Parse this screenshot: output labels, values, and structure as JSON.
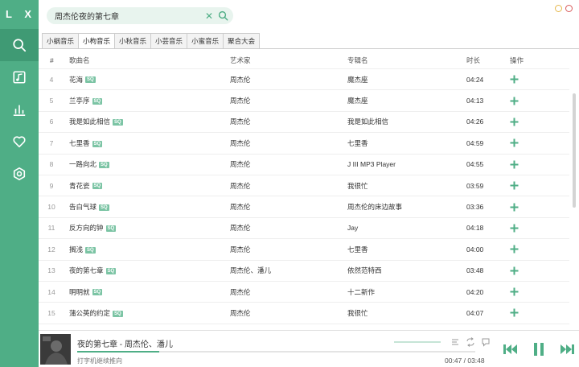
{
  "app": {
    "logo": "L X"
  },
  "sidebar": {
    "items": [
      {
        "icon": "search-icon",
        "active": true
      },
      {
        "icon": "music-file-icon",
        "active": false
      },
      {
        "icon": "chart-icon",
        "active": false
      },
      {
        "icon": "heart-icon",
        "active": false
      },
      {
        "icon": "settings-icon",
        "active": false
      }
    ]
  },
  "search": {
    "value": "周杰伦夜的第七章"
  },
  "tabs": [
    {
      "label": "小蜗音乐",
      "active": false
    },
    {
      "label": "小枸音乐",
      "active": true
    },
    {
      "label": "小秋音乐",
      "active": false
    },
    {
      "label": "小芸音乐",
      "active": false
    },
    {
      "label": "小蜜音乐",
      "active": false
    },
    {
      "label": "聚合大会",
      "active": false
    }
  ],
  "table": {
    "headers": {
      "num": "#",
      "name": "歌曲名",
      "artist": "艺术家",
      "album": "专辑名",
      "duration": "时长",
      "op": "操作"
    },
    "rows": [
      {
        "num": "4",
        "name": "花海",
        "sq": "SQ",
        "artist": "周杰伦",
        "album": "魔杰座",
        "duration": "04:24"
      },
      {
        "num": "5",
        "name": "兰亭序",
        "sq": "SQ",
        "artist": "周杰伦",
        "album": "魔杰座",
        "duration": "04:13"
      },
      {
        "num": "6",
        "name": "我是如此相信",
        "sq": "SQ",
        "artist": "周杰伦",
        "album": "我是如此相信",
        "duration": "04:26"
      },
      {
        "num": "7",
        "name": "七里香",
        "sq": "SQ",
        "artist": "周杰伦",
        "album": "七里香",
        "duration": "04:59"
      },
      {
        "num": "8",
        "name": "一路向北",
        "sq": "SQ",
        "artist": "周杰伦",
        "album": "J III MP3 Player",
        "duration": "04:55"
      },
      {
        "num": "9",
        "name": "青花瓷",
        "sq": "SQ",
        "artist": "周杰伦",
        "album": "我很忙",
        "duration": "03:59"
      },
      {
        "num": "10",
        "name": "告白气球",
        "sq": "SQ",
        "artist": "周杰伦",
        "album": "周杰伦的床边故事",
        "duration": "03:36"
      },
      {
        "num": "11",
        "name": "反方向的钟",
        "sq": "SQ",
        "artist": "周杰伦",
        "album": "Jay",
        "duration": "04:18"
      },
      {
        "num": "12",
        "name": "搁浅",
        "sq": "SQ",
        "artist": "周杰伦",
        "album": "七里香",
        "duration": "04:00"
      },
      {
        "num": "13",
        "name": "夜的第七章",
        "sq": "SQ",
        "artist": "周杰伦、潘儿",
        "album": "依然范特西",
        "duration": "03:48"
      },
      {
        "num": "14",
        "name": "明明就",
        "sq": "SQ",
        "artist": "周杰伦",
        "album": "十二新作",
        "duration": "04:20"
      },
      {
        "num": "15",
        "name": "蒲公英的约定",
        "sq": "SQ",
        "artist": "周杰伦",
        "album": "我很忙",
        "duration": "04:07"
      }
    ]
  },
  "player": {
    "title": "夜的第七章 - 周杰伦、潘儿",
    "subtitle": "打字机继续推向",
    "time": "00:47 / 03:48",
    "progress": 0.206
  },
  "colors": {
    "accent": "#4fae86",
    "accent_dark": "#3f9a74",
    "accent_light": "#e8f4ee"
  }
}
